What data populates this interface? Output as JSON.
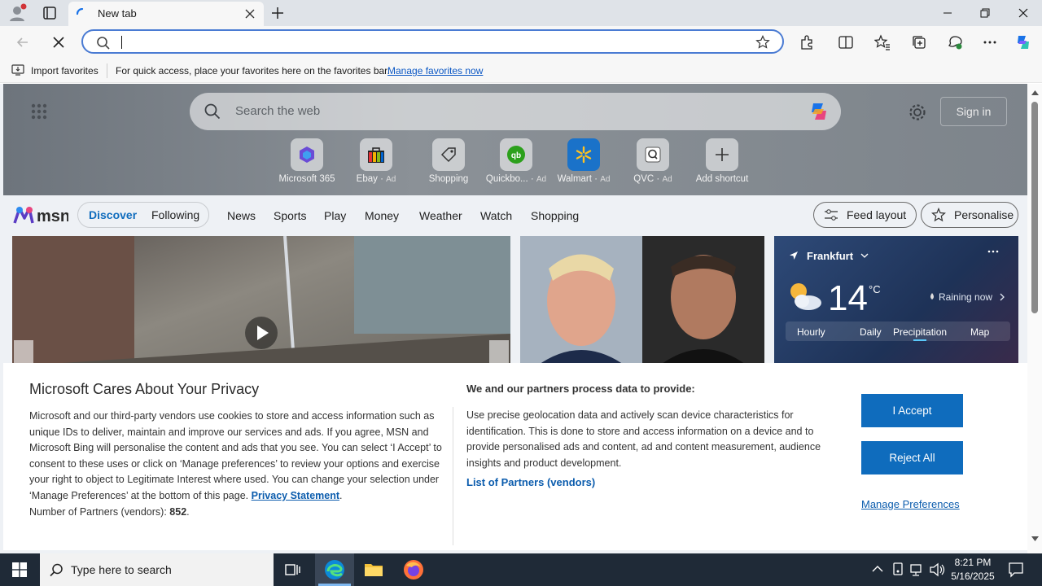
{
  "browser": {
    "tab_title": "New tab",
    "address_value": "",
    "favorites_bar": {
      "import_label": "Import favorites",
      "hint": "For quick access, place your favorites here on the favorites bar.",
      "manage_link": "Manage favorites now"
    }
  },
  "msn": {
    "search_placeholder": "Search the web",
    "sign_in": "Sign in",
    "shortcuts": [
      {
        "label": "Microsoft 365",
        "ad": ""
      },
      {
        "label": "Ebay",
        "ad": "Ad"
      },
      {
        "label": "Shopping",
        "ad": ""
      },
      {
        "label": "Quickbo...",
        "ad": "Ad"
      },
      {
        "label": "Walmart",
        "ad": "Ad"
      },
      {
        "label": "QVC",
        "ad": "Ad"
      },
      {
        "label": "Add shortcut",
        "ad": ""
      }
    ],
    "logo": "msn",
    "nav": {
      "discover": "Discover",
      "following": "Following",
      "items": [
        "News",
        "Sports",
        "Play",
        "Money",
        "Weather",
        "Watch",
        "Shopping"
      ],
      "feed_layout": "Feed layout",
      "personalise": "Personalise"
    },
    "weather": {
      "city": "Frankfurt",
      "temp": "14",
      "unit": "°C",
      "status": "Raining now",
      "tabs": [
        "Hourly",
        "Daily",
        "Precipitation",
        "Map"
      ]
    }
  },
  "privacy": {
    "title": "Microsoft Cares About Your Privacy",
    "body": "Microsoft and our third-party vendors use cookies to store and access information such as unique IDs to deliver, maintain and improve our services and ads. If you agree, MSN and Microsoft Bing will personalise the content and ads that you see. You can select ‘I Accept’ to consent to these uses or click on ‘Manage preferences’ to review your options and exercise your right to object to Legitimate Interest where used.  You can change your selection under ‘Manage Preferences’ at the bottom of this page.",
    "privacy_link": "Privacy Statement",
    "partners_count_label": "Number of Partners (vendors):",
    "partners_count": "852",
    "purposes_title": "We and our partners process data to provide:",
    "purposes_text": "Use precise geolocation data and actively scan device characteristics for identification. This is done to store and access information on a device and to provide personalised ads and content, ad and content measurement, audience insights and product development.",
    "partners_link": "List of Partners (vendors)",
    "accept": "I Accept",
    "reject": "Reject All",
    "manage": "Manage Preferences"
  },
  "taskbar": {
    "search_placeholder": "Type here to search",
    "time": "8:21 PM",
    "date": "5/16/2025"
  },
  "colors": {
    "accent": "#0f6cbd",
    "address_border": "#4a7bd3",
    "taskbar": "#1f2a37"
  }
}
